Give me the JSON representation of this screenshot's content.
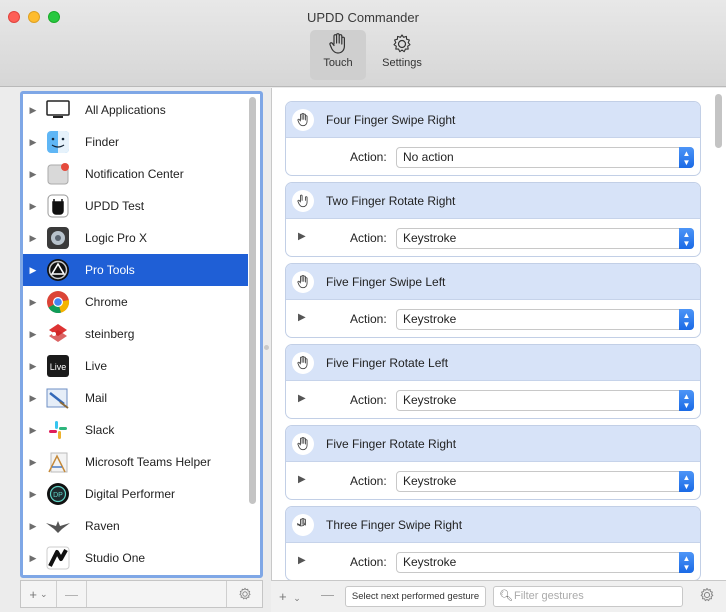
{
  "window": {
    "title": "UPDD Commander"
  },
  "toolbar": {
    "touch_label": "Touch",
    "settings_label": "Settings"
  },
  "applications": [
    {
      "name": "All Applications",
      "icon": "monitor-icon"
    },
    {
      "name": "Finder",
      "icon": "finder-icon"
    },
    {
      "name": "Notification Center",
      "icon": "notification-center-icon"
    },
    {
      "name": "UPDD Test",
      "icon": "updd-test-icon"
    },
    {
      "name": "Logic Pro X",
      "icon": "logic-pro-icon"
    },
    {
      "name": "Pro Tools",
      "icon": "pro-tools-icon",
      "selected": true
    },
    {
      "name": "Chrome",
      "icon": "chrome-icon"
    },
    {
      "name": "steinberg",
      "icon": "steinberg-icon"
    },
    {
      "name": "Live",
      "icon": "live-icon"
    },
    {
      "name": "Mail",
      "icon": "mail-icon"
    },
    {
      "name": "Slack",
      "icon": "slack-icon"
    },
    {
      "name": "Microsoft Teams Helper",
      "icon": "teams-helper-icon"
    },
    {
      "name": "Digital Performer",
      "icon": "digital-performer-icon"
    },
    {
      "name": "Raven",
      "icon": "raven-icon"
    },
    {
      "name": "Studio One",
      "icon": "studio-one-icon"
    }
  ],
  "gestures": [
    {
      "name": "Four Finger Swipe Right",
      "action_label": "Action:",
      "action": "No action",
      "has_play": false
    },
    {
      "name": "Two Finger Rotate Right",
      "action_label": "Action:",
      "action": "Keystroke",
      "has_play": true
    },
    {
      "name": "Five Finger Swipe Left",
      "action_label": "Action:",
      "action": "Keystroke",
      "has_play": true
    },
    {
      "name": "Five Finger Rotate Left",
      "action_label": "Action:",
      "action": "Keystroke",
      "has_play": true
    },
    {
      "name": "Five Finger Rotate Right",
      "action_label": "Action:",
      "action": "Keystroke",
      "has_play": true
    },
    {
      "name": "Three Finger Swipe Right",
      "action_label": "Action:",
      "action": "Keystroke",
      "has_play": true
    }
  ],
  "left_bottom": {
    "add": "+",
    "add_menu": "⌄",
    "remove": "—"
  },
  "right_bottom": {
    "add": "+",
    "add_menu": "⌄",
    "remove": "—",
    "select_next_label": "Select next performed gesture",
    "filter_placeholder": "Filter gestures"
  },
  "colors": {
    "selection": "#1f5fd6",
    "card_header": "#d7e3f8",
    "select_arrow": "#1a6ae6"
  }
}
